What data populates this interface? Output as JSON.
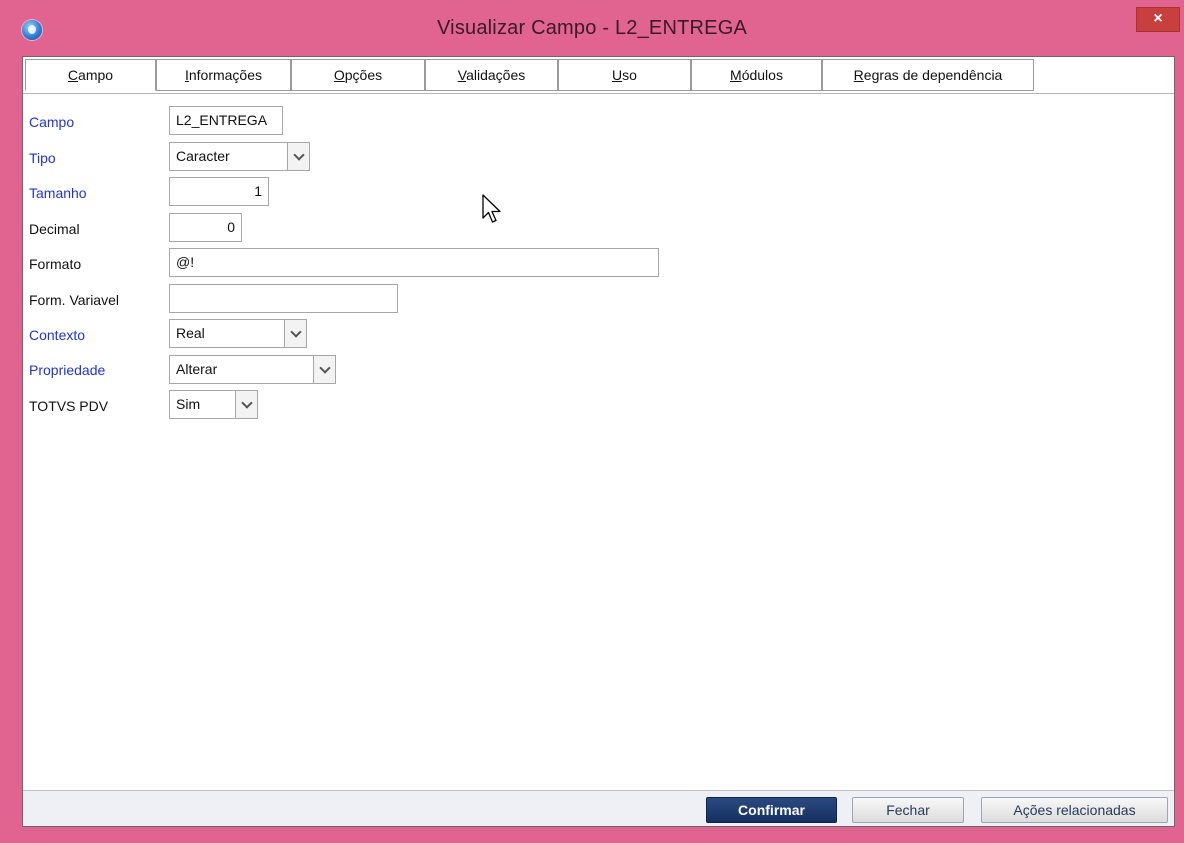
{
  "window": {
    "title": "Visualizar Campo - L2_ENTREGA",
    "close_label": "×",
    "accent_color": "#e0648f"
  },
  "tabs": [
    {
      "label_u": "C",
      "label_rest": "ampo"
    },
    {
      "label_u": "I",
      "label_rest": "nformações"
    },
    {
      "label_u": "O",
      "label_rest": "pções"
    },
    {
      "label_u": "V",
      "label_rest": "alidações"
    },
    {
      "label_u": "U",
      "label_rest": "so"
    },
    {
      "label_u": "M",
      "label_rest": "ódulos"
    },
    {
      "label_u": "R",
      "label_rest": "egras de dependência"
    }
  ],
  "fields": {
    "campo": {
      "label": "Campo",
      "value": "L2_ENTREGA"
    },
    "tipo": {
      "label": "Tipo",
      "value": "Caracter"
    },
    "tamanho": {
      "label": "Tamanho",
      "value": "1"
    },
    "decimal": {
      "label": "Decimal",
      "value": "0"
    },
    "formato": {
      "label": "Formato",
      "value": "@!"
    },
    "form_variavel": {
      "label": "Form. Variavel",
      "value": ""
    },
    "contexto": {
      "label": "Contexto",
      "value": "Real"
    },
    "propriedade": {
      "label": "Propriedade",
      "value": "Alterar"
    },
    "totvs_pdv": {
      "label": "TOTVS PDV",
      "value": "Sim"
    }
  },
  "footer": {
    "confirm_label": "Confirmar",
    "close_label": "Fechar",
    "actions_label": "Ações relacionadas"
  },
  "colors": {
    "required_label": "#1f35d6",
    "primary_button": "#15305f"
  }
}
